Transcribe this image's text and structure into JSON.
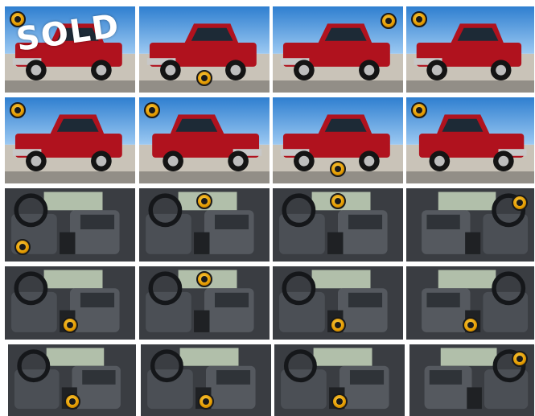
{
  "gallery": {
    "sold_banner": "SOLD",
    "photos": [
      {
        "subject": "truck-front-3q",
        "kind": "ext",
        "wm": "tl",
        "flip": false
      },
      {
        "subject": "truck-rear",
        "kind": "ext",
        "wm": "bc",
        "flip": false
      },
      {
        "subject": "truck-side",
        "kind": "ext",
        "wm": "tr",
        "flip": false
      },
      {
        "subject": "truck-front-closeup",
        "kind": "ext",
        "wm": "tl",
        "flip": false
      },
      {
        "subject": "truck-front-3q-2",
        "kind": "ext",
        "wm": "tl",
        "flip": false
      },
      {
        "subject": "truck-rear-3q",
        "kind": "ext",
        "wm": "tl",
        "flip": true
      },
      {
        "subject": "truck-side-2",
        "kind": "ext",
        "wm": "bc",
        "flip": false
      },
      {
        "subject": "truck-front-3q-3",
        "kind": "ext",
        "wm": "tl",
        "flip": true
      },
      {
        "subject": "interior-driver",
        "kind": "int",
        "wm": "bl",
        "flip": false
      },
      {
        "subject": "interior-driver-2",
        "kind": "int",
        "wm": "tc",
        "flip": false
      },
      {
        "subject": "interior-seats",
        "kind": "int",
        "wm": "tc",
        "flip": false
      },
      {
        "subject": "interior-dash",
        "kind": "int",
        "wm": "tr",
        "flip": true
      },
      {
        "subject": "interior-door",
        "kind": "int",
        "wm": "bc",
        "flip": false
      },
      {
        "subject": "interior-console",
        "kind": "int",
        "wm": "tc",
        "flip": false
      },
      {
        "subject": "interior-dash-2",
        "kind": "int",
        "wm": "bc",
        "flip": false
      },
      {
        "subject": "interior-rear-seats",
        "kind": "int",
        "wm": "bc",
        "flip": true
      },
      {
        "subject": "interior-rear",
        "kind": "int",
        "wm": "bc",
        "flip": false
      },
      {
        "subject": "interior-steering",
        "kind": "int",
        "wm": "bc",
        "flip": false
      },
      {
        "subject": "interior-steering-2",
        "kind": "int",
        "wm": "bc",
        "flip": false
      },
      {
        "subject": "interior-rear-2",
        "kind": "int",
        "wm": "tr",
        "flip": true
      }
    ],
    "colors": {
      "truck_red": "#b0121e",
      "sky": "#3f8fd8",
      "lot": "#c9c3b8",
      "interior": "#3a3d42"
    }
  }
}
